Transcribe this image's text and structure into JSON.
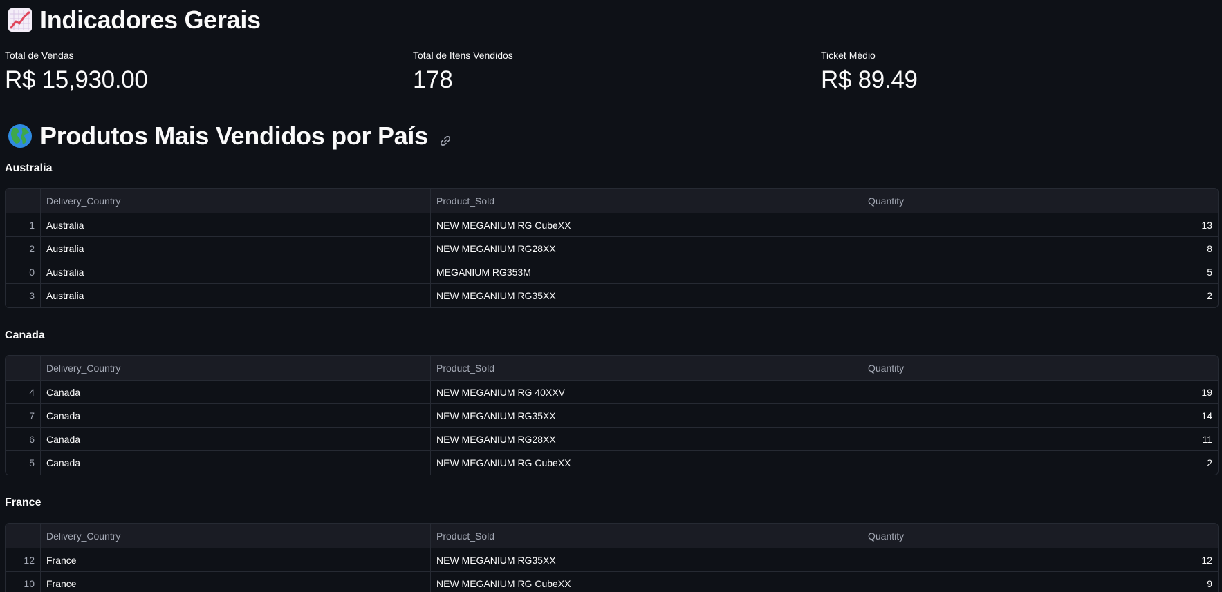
{
  "header_general": {
    "icon": "chart-increasing-icon",
    "title": "Indicadores Gerais"
  },
  "metrics": [
    {
      "label": "Total de Vendas",
      "value": "R$ 15,930.00"
    },
    {
      "label": "Total de Itens Vendidos",
      "value": "178"
    },
    {
      "label": "Ticket Médio",
      "value": "R$ 89.49"
    }
  ],
  "header_products": {
    "icon": "globe-icon",
    "title": "Produtos Mais Vendidos por País",
    "link_icon": "link-icon"
  },
  "columns": [
    "Delivery_Country",
    "Product_Sold",
    "Quantity"
  ],
  "sections": [
    {
      "country": "Australia",
      "rows": [
        {
          "index": "1",
          "country": "Australia",
          "product": "NEW MEGANIUM RG CubeXX",
          "quantity": "13"
        },
        {
          "index": "2",
          "country": "Australia",
          "product": "NEW MEGANIUM RG28XX",
          "quantity": "8"
        },
        {
          "index": "0",
          "country": "Australia",
          "product": "MEGANIUM RG353M",
          "quantity": "5"
        },
        {
          "index": "3",
          "country": "Australia",
          "product": "NEW MEGANIUM RG35XX",
          "quantity": "2"
        }
      ]
    },
    {
      "country": "Canada",
      "rows": [
        {
          "index": "4",
          "country": "Canada",
          "product": "NEW MEGANIUM RG 40XXV",
          "quantity": "19"
        },
        {
          "index": "7",
          "country": "Canada",
          "product": "NEW MEGANIUM RG35XX",
          "quantity": "14"
        },
        {
          "index": "6",
          "country": "Canada",
          "product": "NEW MEGANIUM RG28XX",
          "quantity": "11"
        },
        {
          "index": "5",
          "country": "Canada",
          "product": "NEW MEGANIUM RG CubeXX",
          "quantity": "2"
        }
      ]
    },
    {
      "country": "France",
      "rows": [
        {
          "index": "12",
          "country": "France",
          "product": "NEW MEGANIUM RG35XX",
          "quantity": "12"
        },
        {
          "index": "10",
          "country": "France",
          "product": "NEW MEGANIUM RG CubeXX",
          "quantity": "9"
        }
      ]
    }
  ],
  "colors": {
    "background": "#0e1117",
    "text": "#fafafa",
    "muted": "#a3a8b4",
    "border": "#262a33",
    "header_bg": "#1a1c24"
  }
}
